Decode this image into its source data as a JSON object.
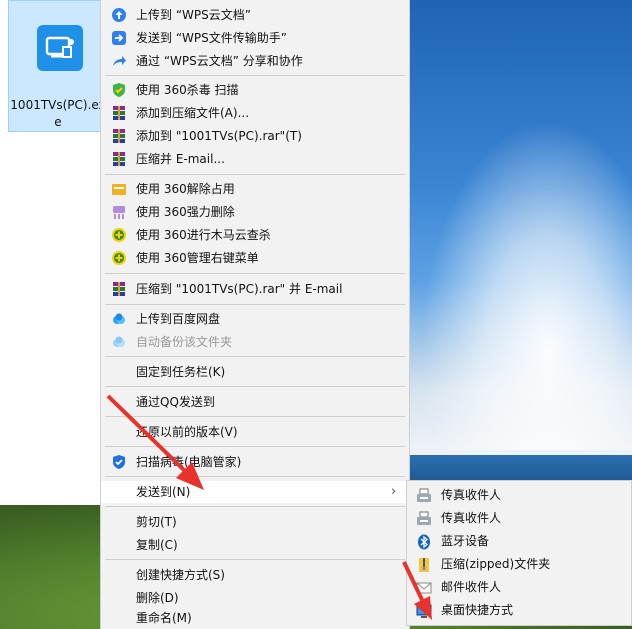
{
  "desktop": {
    "file": {
      "name": "1001TVs(PC).exe",
      "name_line1": "1001TVs(PC).ex",
      "name_line2": "e"
    }
  },
  "context_menu": {
    "items": [
      {
        "label": "上传到 “WPS云文档”",
        "icon": "cloud-upload-icon"
      },
      {
        "label": "发送到 “WPS文件传输助手”",
        "icon": "send-icon"
      },
      {
        "label": "通过 “WPS云文档” 分享和协作",
        "icon": "share-icon"
      },
      {
        "label": "使用 360杀毒 扫描",
        "icon": "shield-icon"
      },
      {
        "label": "添加到压缩文件(A)...",
        "icon": "archive-icon"
      },
      {
        "label": "添加到 \"1001TVs(PC).rar\"(T)",
        "icon": "archive-icon"
      },
      {
        "label": "压缩并 E-mail...",
        "icon": "archive-icon"
      },
      {
        "label": "使用 360解除占用",
        "icon": "unlock-icon"
      },
      {
        "label": "使用 360强力删除",
        "icon": "shred-icon"
      },
      {
        "label": "使用 360进行木马云查杀",
        "icon": "plus-shield-icon"
      },
      {
        "label": "使用 360管理右键菜单",
        "icon": "plus-shield-icon"
      },
      {
        "label": "压缩到 \"1001TVs(PC).rar\" 并 E-mail",
        "icon": "archive-icon"
      },
      {
        "label": "上传到百度网盘",
        "icon": "baidu-cloud-icon"
      },
      {
        "label": "自动备份该文件夹",
        "icon": "baidu-cloud-icon"
      },
      {
        "label": "固定到任务栏(K)"
      },
      {
        "label": "通过QQ发送到"
      },
      {
        "label": "还原以前的版本(V)"
      },
      {
        "label": "扫描病毒(电脑管家)",
        "icon": "tencent-shield-icon"
      },
      {
        "label": "发送到(N)",
        "has_submenu": true
      },
      {
        "label": "剪切(T)"
      },
      {
        "label": "复制(C)"
      },
      {
        "label": "创建快捷方式(S)"
      },
      {
        "label": "删除(D)"
      },
      {
        "label": "重命名(M)"
      }
    ]
  },
  "send_to_submenu": {
    "items": [
      {
        "label": "传真收件人",
        "icon": "fax-icon"
      },
      {
        "label": "传真收件人",
        "icon": "fax-icon"
      },
      {
        "label": "蓝牙设备",
        "icon": "bluetooth-icon"
      },
      {
        "label": "压缩(zipped)文件夹",
        "icon": "zip-folder-icon"
      },
      {
        "label": "邮件收件人",
        "icon": "mail-icon"
      },
      {
        "label": "桌面快捷方式",
        "icon": "desktop-icon"
      }
    ]
  },
  "colors": {
    "menu_bg": "#f2f2f2",
    "hover_bg": "#ffffff",
    "selection_bg": "#cce8ff",
    "arrow_red": "#e8322b",
    "icon_blue": "#1e90e8"
  }
}
